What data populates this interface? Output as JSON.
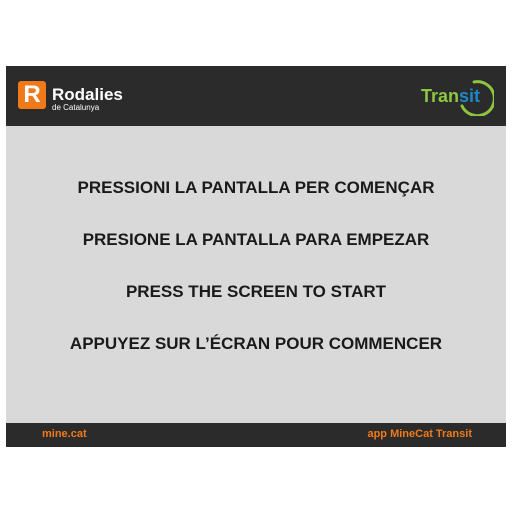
{
  "header": {
    "logo_letter": "R",
    "brand_name": "Rodalies",
    "brand_sub": "de Catalunya",
    "transit_part1": "Tran",
    "transit_part2": "sit"
  },
  "messages": [
    "PRESSIONI LA PANTALLA PER COMENÇAR",
    "PRESIONE LA PANTALLA PARA EMPEZAR",
    "PRESS THE SCREEN TO START",
    "APPUYEZ SUR L’ÉCRAN POUR COMMENCER"
  ],
  "footer": {
    "left": "mine.cat",
    "right": "app MineCat Transit"
  },
  "colors": {
    "header_bg": "#2b2b2b",
    "screen_bg": "#d9d9d9",
    "accent_orange": "#f07a19",
    "transit_green": "#8dc63f",
    "transit_blue": "#1e88c7"
  },
  "icons": {
    "brand_logo": "rodalies-r-logo",
    "transit_logo": "transit-ring-logo"
  }
}
